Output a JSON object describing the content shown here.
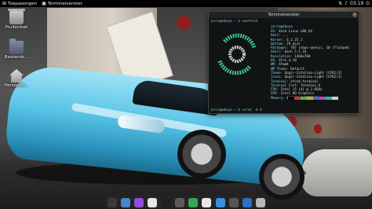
{
  "topbar": {
    "activities_label": "Toepassingen",
    "active_app_label": "Terminalvenster",
    "clock": "03:19"
  },
  "desktop_icons": [
    {
      "label": "Prullenbak",
      "icon": "trash-icon"
    },
    {
      "label": "Bestands...",
      "icon": "folder-icon"
    },
    {
      "label": "Persoonli...",
      "icon": "home-folder-icon"
    }
  ],
  "terminal": {
    "title": "Terminalvenster",
    "prompt_1": "jerio@aboya ~ $ neofetch",
    "user_host": "jerio@aboya",
    "info": [
      {
        "key": "OS",
        "value": "Void Linux x86_64"
      },
      {
        "key": "Host",
        "value": "..."
      },
      {
        "key": "Kernel",
        "value": "6.1.25_1"
      },
      {
        "key": "Uptime",
        "value": "29 mins"
      },
      {
        "key": "Packages",
        "value": "707 (xbps-query), 10 (flatpak)"
      },
      {
        "key": "Shell",
        "value": "bash 5.1.16"
      },
      {
        "key": "Resolution",
        "value": "1366x768"
      },
      {
        "key": "DE",
        "value": "Xfce 4.18"
      },
      {
        "key": "WM",
        "value": "Xfwm4"
      },
      {
        "key": "WM Theme",
        "value": "Default"
      },
      {
        "key": "Theme",
        "value": "Qogir-Catalina-Light [GTK2/3]"
      },
      {
        "key": "Icons",
        "value": "Qogir-Catalina-Light [GTK2/3]"
      },
      {
        "key": "Terminal",
        "value": "xfce4-terminal"
      },
      {
        "key": "Terminal Font",
        "value": "Terminus 6"
      },
      {
        "key": "CPU",
        "value": "Intel i5 (4) @ 2.6GHz"
      },
      {
        "key": "GPU",
        "value": "Intel HD Graphics"
      },
      {
        "key": "Memory",
        "value": "494MiB / 3735MiB"
      }
    ],
    "prompt_2": "jerio@aboya ~ $ scrot -d 4",
    "swatch_colors": [
      "#000000",
      "#cc3333",
      "#4fb04f",
      "#c8a82a",
      "#3b6fd1",
      "#b04fb0",
      "#2fb3b3",
      "#d0d0d0"
    ]
  },
  "dock": {
    "items": [
      {
        "icon": "files-icon",
        "color": "#3a3a3a"
      },
      {
        "icon": "image-viewer-icon",
        "color": "#4a86c9"
      },
      {
        "icon": "app-store-icon",
        "color": "#8d4fd6"
      },
      {
        "icon": "calendar-icon",
        "color": "#e6e6e6"
      },
      {
        "icon": "terminal-icon",
        "color": "#1f1f1f"
      },
      {
        "icon": "settings-icon",
        "color": "#5a5a5a"
      },
      {
        "icon": "leaf-icon",
        "color": "#3aa35a"
      },
      {
        "icon": "chrome-icon",
        "color": "#e8e8e8"
      },
      {
        "icon": "safari-icon",
        "color": "#3b8ee0"
      },
      {
        "icon": "app-icon",
        "color": "#555555"
      },
      {
        "icon": "word-icon",
        "color": "#2b6fc7"
      },
      {
        "icon": "trash-icon",
        "color": "#b8b8b8"
      }
    ]
  }
}
